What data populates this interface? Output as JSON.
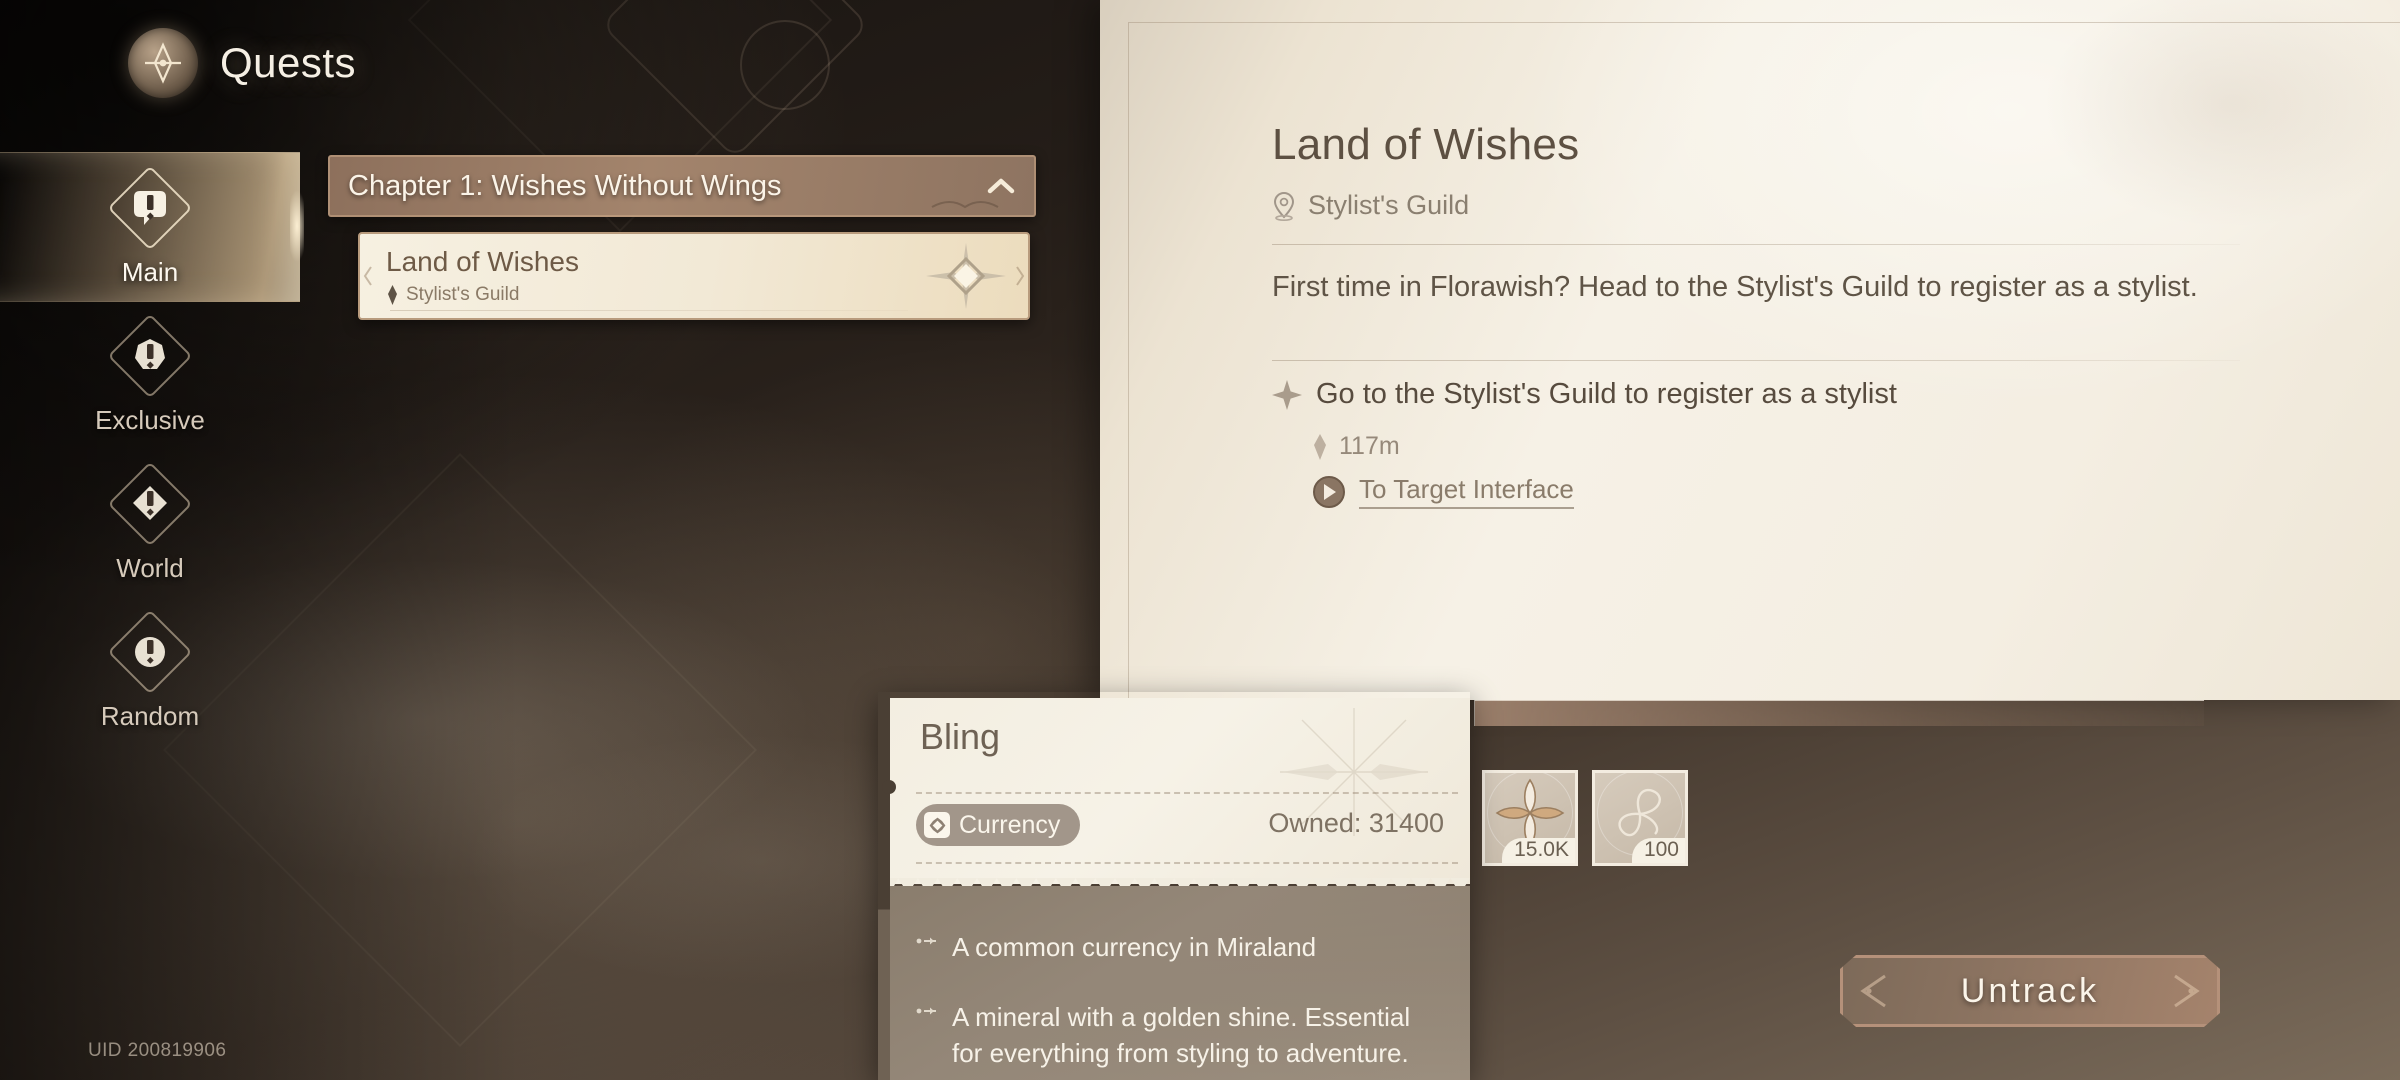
{
  "header": {
    "title": "Quests",
    "emblem_icon": "compass-emblem-icon"
  },
  "sidebar": {
    "items": [
      {
        "label": "Main",
        "icon": "quest-main-icon",
        "active": true
      },
      {
        "label": "Exclusive",
        "icon": "quest-exclusive-icon",
        "active": false
      },
      {
        "label": "World",
        "icon": "quest-world-icon",
        "active": false
      },
      {
        "label": "Random",
        "icon": "quest-random-icon",
        "active": false
      }
    ],
    "uid": "UID 200819906"
  },
  "quest_list": {
    "chapter": {
      "title": "Chapter 1: Wishes Without Wings",
      "collapse_icon": "chevron-up-icon",
      "expanded": true
    },
    "quests": [
      {
        "name": "Land of Wishes",
        "location": "Stylist's Guild",
        "location_icon": "map-pin-icon",
        "selected": true
      }
    ]
  },
  "detail": {
    "title": "Land of Wishes",
    "location": "Stylist's Guild",
    "location_icon": "map-pin-icon",
    "description": "First time in Florawish? Head to the Stylist's Guild to register as a stylist.",
    "objective": {
      "text": "Go to the Stylist's Guild to register as a stylist",
      "icon": "four-point-star-icon"
    },
    "distance": {
      "value": "117m",
      "icon": "distance-marker-icon"
    },
    "target_link": {
      "label": "To Target Interface",
      "icon": "arrow-circle-right-icon"
    }
  },
  "rewards": {
    "items": [
      {
        "quantity": "15.0K",
        "icon": "bling-flower-icon"
      },
      {
        "quantity": "100",
        "icon": "butterfly-icon"
      }
    ]
  },
  "actions": {
    "untrack_label": "Untrack"
  },
  "tooltip": {
    "title": "Bling",
    "tag": {
      "label": "Currency",
      "icon": "currency-badge-icon"
    },
    "owned_label": "Owned:",
    "owned_value": "31400",
    "descriptions": [
      "A common currency in Miraland",
      "A mineral with a golden shine. Essential for everything from styling to adventure."
    ]
  },
  "colors": {
    "accent_gold": "#e2c69c",
    "panel_cream": "#f6f1e6",
    "chapter_brown": "#a3846c",
    "tooltip_body": "#8a7d6d"
  }
}
